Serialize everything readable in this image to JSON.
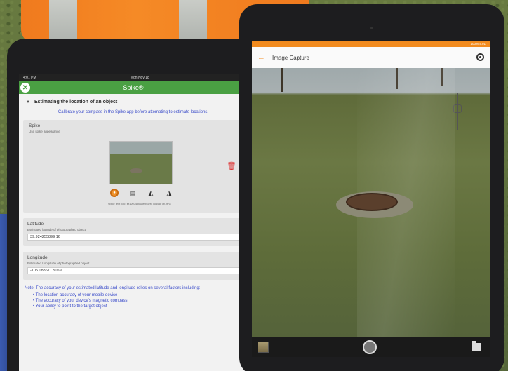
{
  "tablet_left": {
    "status": {
      "time": "4:01 PM",
      "date": "Mon Nov 18"
    },
    "app_title": "Spike®",
    "section_title": "Estimating the location of an object",
    "calibrate": {
      "link": "Calibrate your compass in the Spike app",
      "rest": " before attempting to estimate locations."
    },
    "spike": {
      "label": "Spike",
      "sublabel": "Use spike appearance",
      "filename": "spike_ext_loc_ef12074bc68f9b32f57cd45e7b.JPG"
    },
    "latitude": {
      "label": "Latitude",
      "sublabel": "Estimated latitude of photographed object",
      "value": "39.924255899 16"
    },
    "longitude": {
      "label": "Longitude",
      "sublabel": "Estimated Longitude of photographed object",
      "value": "-105.088671 5059"
    },
    "note": {
      "intro": "Note: The accuracy of your estimated latitude and longitude relies on several factors including:",
      "items": [
        "The location accuracy of your mobile device",
        "The accuracy of your device's magnetic compass",
        "Your ability to point to the target object"
      ]
    }
  },
  "tablet_right": {
    "status": {
      "right": "100% 4:01"
    },
    "app_title": "Image Capture"
  },
  "colors": {
    "spike_green": "#4aa043",
    "accent_orange": "#f28b1e",
    "link_blue": "#3a4bc9"
  }
}
